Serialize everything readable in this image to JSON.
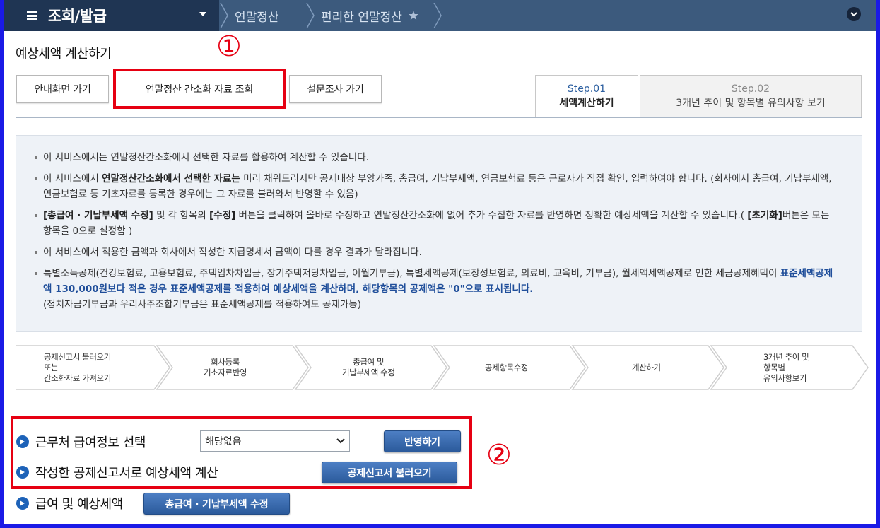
{
  "nav": {
    "menu_title": "조회/발급",
    "breadcrumb": [
      "연말정산",
      "편리한 연말정산"
    ]
  },
  "page": {
    "title": "예상세액 계산하기"
  },
  "annotations": {
    "marker_1": "①",
    "marker_2": "②",
    "highlight_color": "#e60012"
  },
  "actions": {
    "guide_button": "안내화면 가기",
    "simplified_lookup_button": "연말정산 간소화 자료 조회",
    "survey_button": "설문조사 가기"
  },
  "tabs": [
    {
      "step": "Step.01",
      "label": "세액계산하기",
      "active": true
    },
    {
      "step": "Step.02",
      "label": "3개년 추이 및 항목별 유의사항 보기",
      "active": false
    }
  ],
  "info": {
    "item1": "이 서비스에서는 연말정산간소화에서 선택한 자료를 활용하여 계산할 수 있습니다.",
    "item2_pre": "이 서비스에서 ",
    "item2_bold": "연말정산간소화에서 선택한 자료는",
    "item2_post": " 미리 채워드리지만 공제대상 부양가족, 총급여, 기납부세액, 연금보험료 등은 근로자가 직접 확인, 입력하여야 합니다. (회사에서 총급여, 기납부세액, 연금보험료 등 기초자료를 등록한 경우에는 그 자료를 불러와서 반영할 수 있음)",
    "item3_bold1": "[총급여 · 기납부세액 수정]",
    "item3_mid1": " 및 각 항목의 ",
    "item3_bold2": "[수정]",
    "item3_mid2": " 버튼을 클릭하여 올바로 수정하고 연말정산간소화에 없어 추가 수집한 자료를 반영하면 정확한 예상세액을 계산할 수 있습니다.( ",
    "item3_bold3": "[초기화]",
    "item3_post": "버튼은 모든 항목을 0으로 설정함 )",
    "item4": "이 서비스에서 적용한 금액과 회사에서 작성한 지급명세서 금액이 다를 경우 결과가 달라집니다.",
    "item5_pre": "특별소득공제(건강보험료, 고용보험료, 주택임차차입금, 장기주택저당차입금, 이월기부금), 특별세액공제(보장성보험료, 의료비, 교육비, 기부금), 월세액세액공제로 인한 세금공제혜택이 ",
    "item5_blue": "표준세액공제액 130,000원보다 적은 경우 표준세액공제를 적용하여 예상세액을 계산하며, 해당항목의 공제액은 \"0\"으로 표시됩니다.",
    "item5_post": "(정치자금기부금과 우리사주조합기부금은 표준세액공제를 적용하여도 공제가능)"
  },
  "process_steps": [
    [
      "공제신고서 불러오기",
      "또는",
      "간소화자료 가져오기"
    ],
    [
      "회사등록",
      "기초자료반영"
    ],
    [
      "총급여 및",
      "기납부세액 수정"
    ],
    [
      "공제항목수정"
    ],
    [
      "계산하기"
    ],
    [
      "3개년 추이 및",
      "항목별",
      "유의사항보기"
    ]
  ],
  "form": {
    "workplace_label": "근무처 급여정보 선택",
    "workplace_select_value": "해당없음",
    "apply_button": "반영하기",
    "declaration_label": "작성한 공제신고서로 예상세액 계산",
    "load_declaration_button": "공제신고서 불러오기",
    "salary_label": "급여 및 예상세액",
    "salary_edit_button": "총급여 · 기납부세액 수정"
  }
}
